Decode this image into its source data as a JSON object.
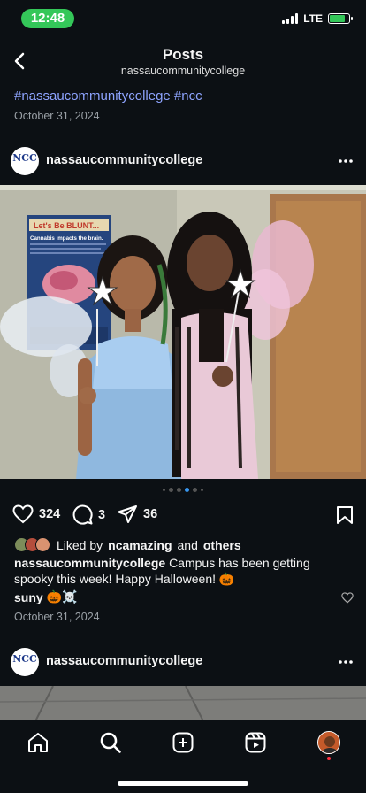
{
  "status": {
    "time": "12:48",
    "network": "LTE",
    "battery_level": 0.8
  },
  "header": {
    "title": "Posts",
    "subtitle": "nassaucommunitycollege"
  },
  "post_top": {
    "hashtags": "#nassaucommunitycollege #ncc",
    "date": "October 31, 2024"
  },
  "post": {
    "username": "nassaucommunitycollege",
    "avatar_text": "NCC",
    "poster_title": "Let's Be BLUNT...",
    "poster_subtitle": "Cannabis impacts the brain.",
    "carousel": {
      "count": 6,
      "active": 3
    },
    "likes": "324",
    "comments": "3",
    "shares": "36",
    "liked_by_prefix": "Liked by",
    "liked_by_user": "ncamazing",
    "liked_by_and": "and",
    "liked_by_others": "others",
    "caption_user": "nassaucommunitycollege",
    "caption_text": "Campus has been getting spooky this week! Happy Halloween! 🎃",
    "comment_user": "suny",
    "comment_text": "🎃☠️",
    "date": "October 31, 2024"
  },
  "next_post": {
    "username": "nassaucommunitycollege",
    "avatar_text": "NCC"
  },
  "tabs": [
    {
      "name": "home-icon"
    },
    {
      "name": "search-icon"
    },
    {
      "name": "create-icon"
    },
    {
      "name": "reels-icon"
    },
    {
      "name": "profile-avatar"
    }
  ],
  "colors": {
    "background": "#0c1014",
    "link": "#8ea4ff",
    "accent": "#3897f0",
    "status_green": "#34c759"
  }
}
